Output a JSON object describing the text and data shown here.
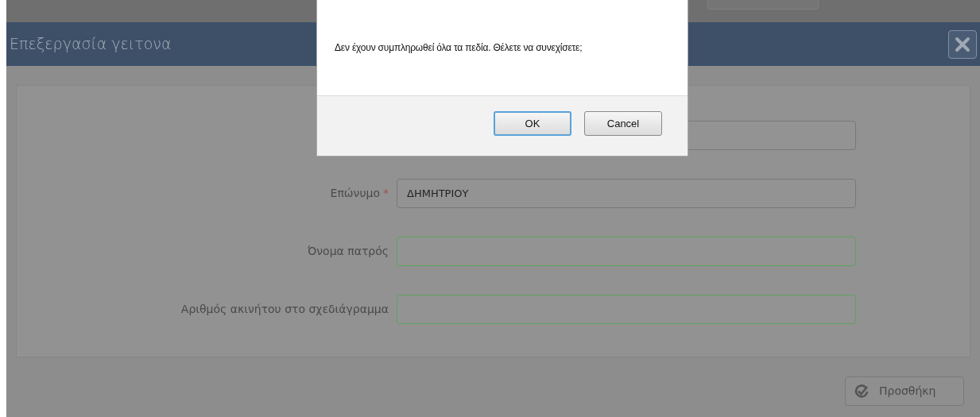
{
  "dialog": {
    "title": "Επεξεργασία γειτονα",
    "fields": [
      {
        "valid": false
      },
      {
        "label": "Επώνυμο",
        "required_mark": "*",
        "value": "ΔΗΜΗΤΡΙΟΥ",
        "valid": false
      },
      {
        "label": "Όνομα πατρός",
        "valid": true
      },
      {
        "label": "Αριθμός ακινήτου στο σχεδιάγραμμα",
        "valid": true
      }
    ],
    "button": "Προσθήκη"
  },
  "alert": {
    "message": "Δεν έχουν συμπληρωθεί όλα τα πεδία. Θέλετε να συνεχίσετε;",
    "buttons": [
      {
        "label": "OK",
        "selected": true
      },
      {
        "label": "Cancel",
        "selected": false
      }
    ]
  }
}
